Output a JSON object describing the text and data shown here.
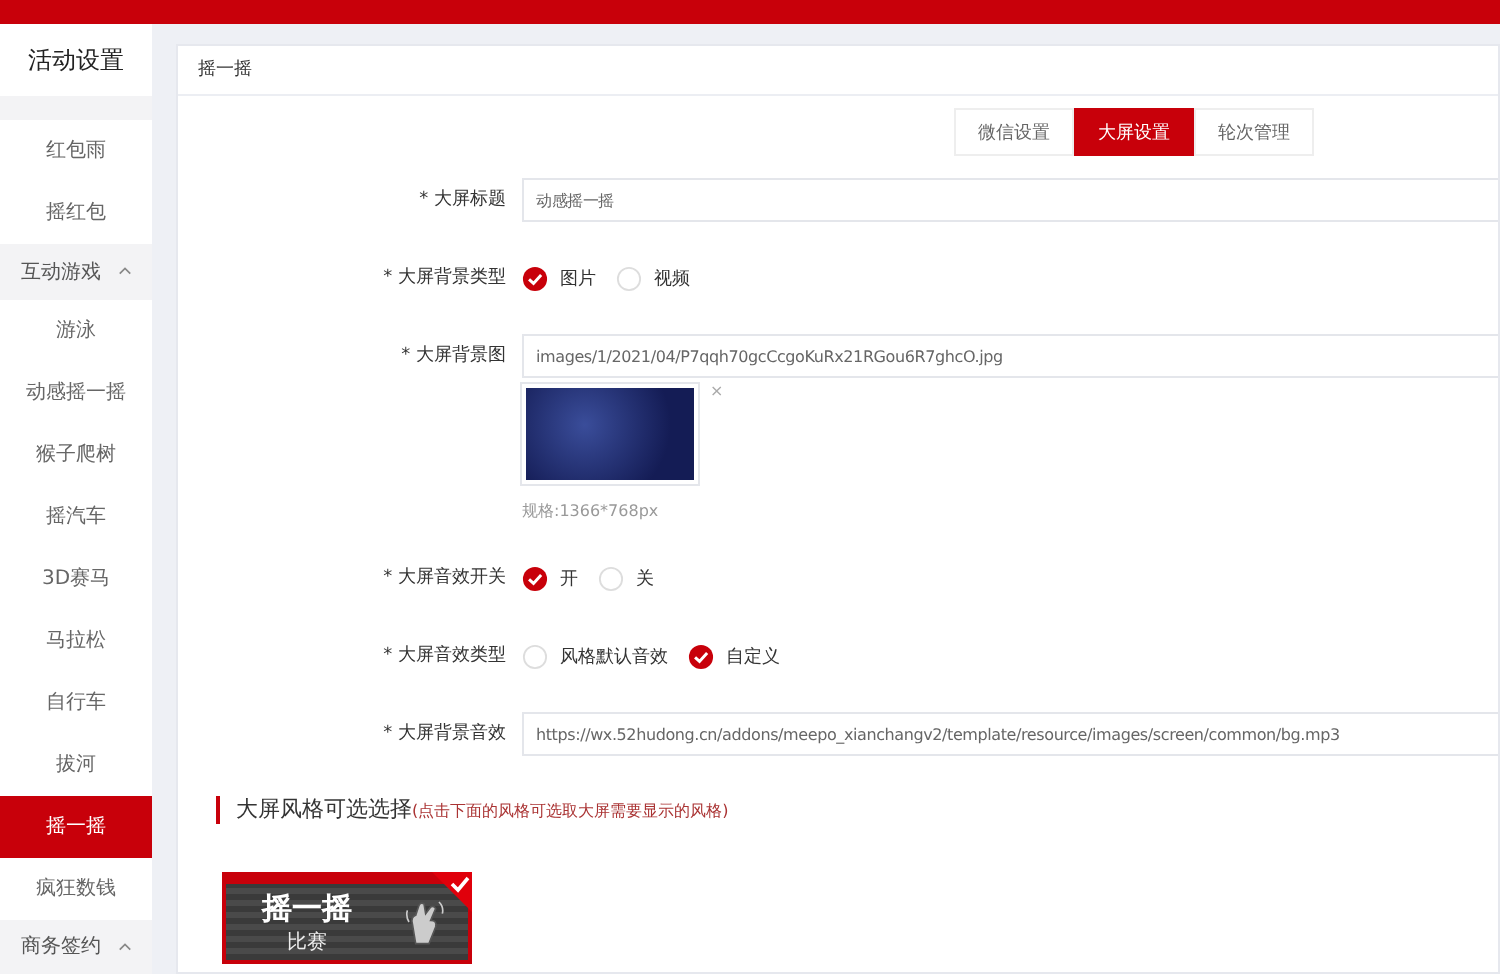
{
  "sidebar": {
    "title": "活动设置",
    "items": [
      {
        "label": "红包雨",
        "selected": false
      },
      {
        "label": "摇红包",
        "selected": false
      },
      {
        "label": "互动游戏",
        "expanded": true,
        "children": [
          {
            "label": "游泳",
            "selected": false
          },
          {
            "label": "动感摇一摇",
            "selected": false
          },
          {
            "label": "猴子爬树",
            "selected": false
          },
          {
            "label": "摇汽车",
            "selected": false
          },
          {
            "label": "3D赛马",
            "selected": false
          },
          {
            "label": "马拉松",
            "selected": false
          },
          {
            "label": "自行车",
            "selected": false
          },
          {
            "label": "拔河",
            "selected": false
          },
          {
            "label": "摇一摇",
            "selected": true
          },
          {
            "label": "疯狂数钱",
            "selected": false
          }
        ]
      },
      {
        "label": "商务签约",
        "expanded": true
      }
    ]
  },
  "panel": {
    "title": "摇一摇",
    "tabs": [
      {
        "label": "微信设置",
        "selected": false
      },
      {
        "label": "大屏设置",
        "selected": true
      },
      {
        "label": "轮次管理",
        "selected": false
      }
    ],
    "fields": [
      {
        "kind": "text",
        "label": "* 大屏标题",
        "value": "动感摇一摇"
      },
      {
        "kind": "radio",
        "label": "* 大屏背景类型",
        "options": [
          {
            "label": "图片",
            "selected": true
          },
          {
            "label": "视频",
            "selected": false
          }
        ]
      },
      {
        "kind": "image",
        "label": "* 大屏背景图",
        "value": "images/1/2021/04/P7qqh70gcCcgoKuRx21RGou6R7ghcO.jpg",
        "remove": "×",
        "hint": "规格:1366*768px"
      },
      {
        "kind": "radio",
        "label": "* 大屏音效开关",
        "options": [
          {
            "label": "开",
            "selected": true
          },
          {
            "label": "关",
            "selected": false
          }
        ]
      },
      {
        "kind": "radio",
        "label": "* 大屏音效类型",
        "options": [
          {
            "label": "风格默认音效",
            "selected": false
          },
          {
            "label": "自定义",
            "selected": true
          }
        ]
      },
      {
        "kind": "text",
        "label": "* 大屏背景音效",
        "value": "https://wx.52hudong.cn/addons/meepo_xianchangv2/template/resource/images/screen/common/bg.mp3"
      }
    ],
    "styles_section": {
      "title": "大屏风格可选选择",
      "hint": "(点击下面的风格可选取大屏需要显示的风格)",
      "styles": [
        {
          "title": "摇一摇",
          "subtitle": "比赛",
          "selected": true
        }
      ]
    }
  }
}
